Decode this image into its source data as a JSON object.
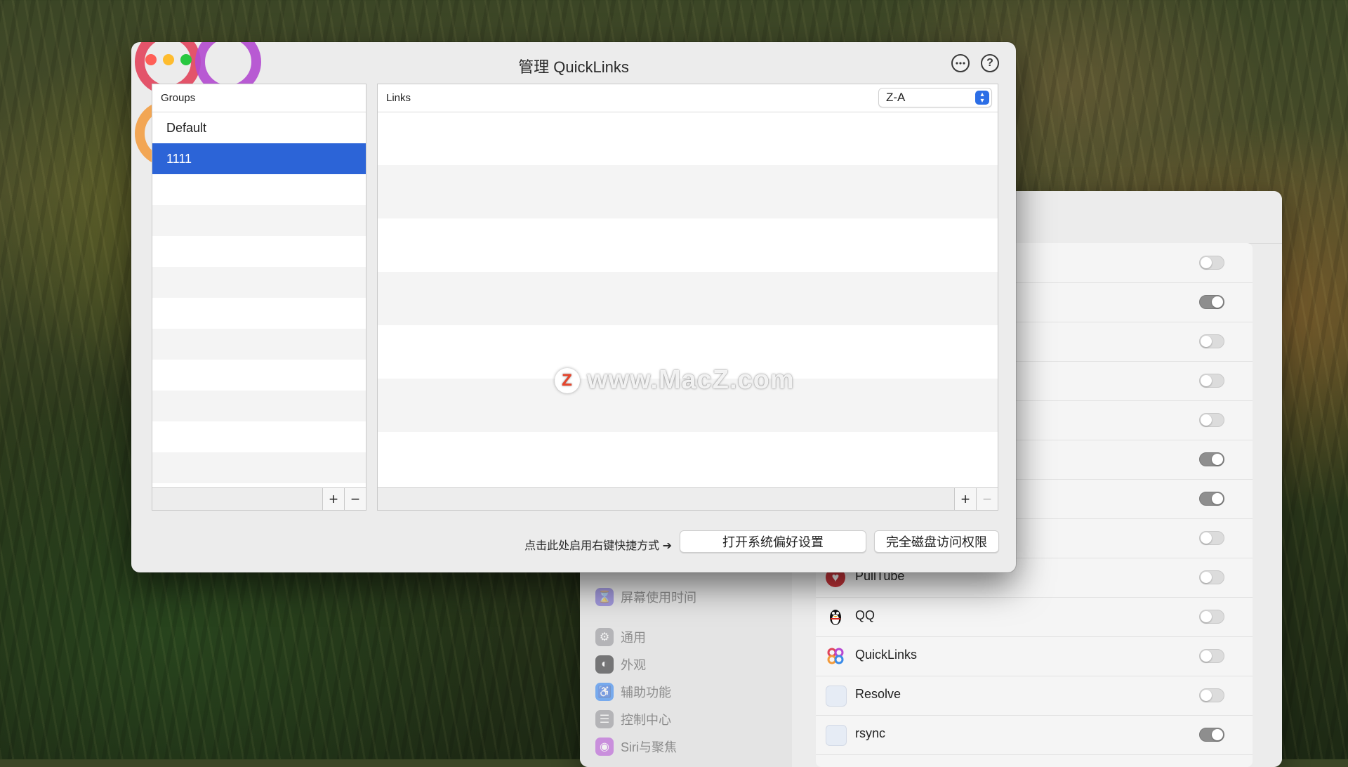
{
  "window": {
    "title": "管理 QuickLinks",
    "more_icon": "ellipsis-circle-icon",
    "help_label": "?"
  },
  "groups_panel": {
    "header": "Groups",
    "items": [
      "Default",
      "1111"
    ],
    "selected": "1111",
    "add_label": "+",
    "remove_label": "−"
  },
  "links_panel": {
    "header": "Links",
    "sort_value": "Z-A",
    "add_label": "+",
    "remove_label": "−"
  },
  "footer": {
    "hint": "点击此处启用右键快捷方式 ➔",
    "open_prefs_button": "打开系统偏好设置",
    "full_disk_button": "完全磁盘访问权限"
  },
  "watermark": {
    "logo": "Z",
    "text": "www.MacZ.com"
  },
  "settings_sidebar": {
    "items": [
      {
        "label": "屏幕使用时间",
        "icon": "hourglass-icon",
        "color": "#6c5bd4"
      },
      {
        "label": "通用",
        "icon": "gear-icon",
        "color": "#8e8e93"
      },
      {
        "label": "外观",
        "icon": "appearance-icon",
        "color": "#1c1c1e"
      },
      {
        "label": "辅助功能",
        "icon": "accessibility-icon",
        "color": "#1f7cf5"
      },
      {
        "label": "控制中心",
        "icon": "control-center-icon",
        "color": "#8e8e93"
      },
      {
        "label": "Siri与聚焦",
        "icon": "siri-icon",
        "color": "#b44bd6"
      }
    ]
  },
  "settings_apps": {
    "items": [
      {
        "name": "",
        "on": false
      },
      {
        "name": "",
        "on": true
      },
      {
        "name": "",
        "on": false
      },
      {
        "name": "",
        "on": false
      },
      {
        "name": "",
        "on": false
      },
      {
        "name": "",
        "on": true
      },
      {
        "name": "",
        "on": true
      },
      {
        "name": "",
        "on": false
      },
      {
        "name": "PullTube",
        "on": false,
        "icon": "pulltube-icon"
      },
      {
        "name": "QQ",
        "on": false,
        "icon": "qq-penguin-icon"
      },
      {
        "name": "QuickLinks",
        "on": false,
        "icon": "quicklinks-icon"
      },
      {
        "name": "Resolve",
        "on": false,
        "icon": "generic-app-icon"
      },
      {
        "name": "rsync",
        "on": true,
        "icon": "generic-app-icon"
      }
    ]
  },
  "colors": {
    "selection": "#2c64d7",
    "accent": "#2c6ee6"
  }
}
